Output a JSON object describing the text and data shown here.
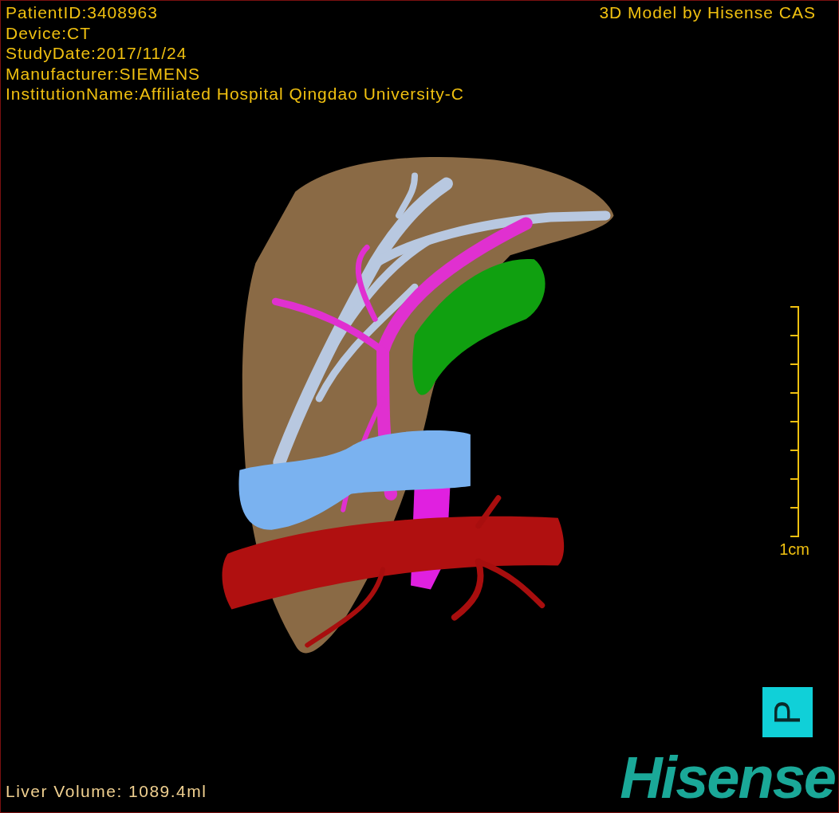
{
  "info_lines": [
    "PatientID:3408963",
    "Device:CT",
    "StudyDate:2017/11/24",
    "Manufacturer:SIEMENS",
    "InstitutionName:Affiliated Hospital Qingdao University-C"
  ],
  "title": "3D Model by Hisense CAS",
  "scale": {
    "label": "1cm"
  },
  "orientation_marker": "P",
  "liver_volume": "Liver Volume: 1089.4ml",
  "logo": "Hisense"
}
